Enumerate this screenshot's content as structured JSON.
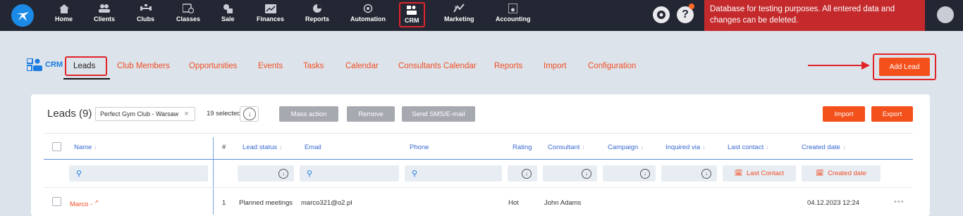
{
  "nav": {
    "items": [
      {
        "label": "Home",
        "icon": "home-icon"
      },
      {
        "label": "Clients",
        "icon": "users-icon"
      },
      {
        "label": "Clubs",
        "icon": "dumbbell-icon"
      },
      {
        "label": "Classes",
        "icon": "calendar-clock-icon"
      },
      {
        "label": "Sale",
        "icon": "sale-icon"
      },
      {
        "label": "Finances",
        "icon": "chart-icon"
      },
      {
        "label": "Reports",
        "icon": "pie-chart-icon"
      },
      {
        "label": "Automation",
        "icon": "automation-icon"
      },
      {
        "label": "CRM",
        "icon": "crm-icon"
      },
      {
        "label": "Marketing",
        "icon": "marketing-icon"
      },
      {
        "label": "Accounting",
        "icon": "accounting-icon"
      }
    ],
    "help_label": "?",
    "banner_text": "Database for testing purposes. All entered data and changes can be deleted."
  },
  "crm": {
    "brand_label": "CRM",
    "tabs": [
      "Leads",
      "Club Members",
      "Opportunities",
      "Events",
      "Tasks",
      "Calendar",
      "Consultants Calendar",
      "Reports",
      "Import",
      "Configuration"
    ],
    "add_lead_label": "Add Lead"
  },
  "leads": {
    "title": "Leads (9)",
    "filter_chip": "Perfect Gym Club - Warsaw",
    "filter_chip_close": "×",
    "selected_text": "19 selected",
    "buttons": {
      "mass_action": "Mass action",
      "remove": "Remove",
      "send": "Send SMS/E-mail",
      "import": "Import",
      "export": "Export"
    },
    "columns": {
      "name": "Name",
      "hash": "#",
      "lead_status": "Lead status",
      "email": "Email",
      "phone": "Phone",
      "rating": "Rating",
      "consultant": "Consultant",
      "campaign": "Campaign",
      "inquired_via": "Inquired via",
      "last_contact": "Last contact",
      "created_date": "Created date"
    },
    "filters": {
      "last_contact_label": "Last Contact",
      "created_date_label": "Created date"
    },
    "rows": [
      {
        "name": "Marco -",
        "number": "1",
        "lead_status": "Planned meetings",
        "email": "marco321@o2.pl",
        "phone": "",
        "rating": "Hot",
        "consultant": "John Adams",
        "campaign": "",
        "inquired_via": "",
        "last_contact": "",
        "created_date": "04.12.2023 12:24"
      }
    ]
  },
  "colors": {
    "accent_orange": "#f4501c",
    "brand_blue": "#1a7be0",
    "navbar": "#232733",
    "banner_red": "#c42a2c"
  }
}
